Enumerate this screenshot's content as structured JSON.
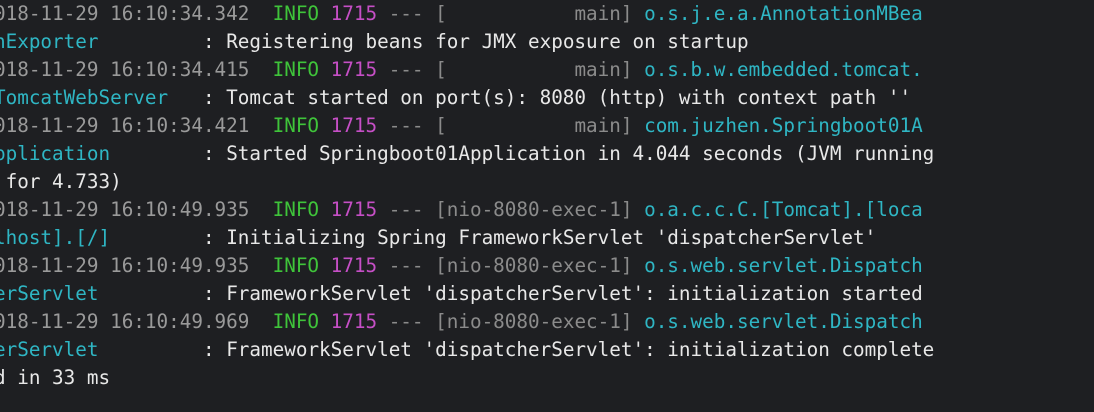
{
  "log": {
    "entries": [
      {
        "timestamp": "018-11-29 16:10:34.342",
        "level": "INFO",
        "pid": "1715",
        "sep": "---",
        "thread": "[           main]",
        "logger_part1": "o.s.j.e.a.AnnotationMBea",
        "logger_part2": "nExporter",
        "colon": ":",
        "message": "Registering beans for JMX exposure on startup",
        "message_cont": ""
      },
      {
        "timestamp": "018-11-29 16:10:34.415",
        "level": "INFO",
        "pid": "1715",
        "sep": "---",
        "thread": "[           main]",
        "logger_part1": "o.s.b.w.embedded.tomcat.",
        "logger_part2": "TomcatWebServer",
        "colon": ":",
        "message": "Tomcat started on port(s): 8080 (http) with context path ''",
        "message_cont": ""
      },
      {
        "timestamp": "018-11-29 16:10:34.421",
        "level": "INFO",
        "pid": "1715",
        "sep": "---",
        "thread": "[           main]",
        "logger_part1": "com.juzhen.Springboot01A",
        "logger_part2": "pplication",
        "colon": ":",
        "message": "Started Springboot01Application in 4.044 seconds (JVM running",
        "message_cont": " for 4.733)"
      },
      {
        "timestamp": "018-11-29 16:10:49.935",
        "level": "INFO",
        "pid": "1715",
        "sep": "---",
        "thread": "[nio-8080-exec-1]",
        "logger_part1": "o.a.c.c.C.[Tomcat].[loca",
        "logger_part2": "lhost].[/]",
        "colon": ":",
        "message": "Initializing Spring FrameworkServlet 'dispatcherServlet'",
        "message_cont": ""
      },
      {
        "timestamp": "018-11-29 16:10:49.935",
        "level": "INFO",
        "pid": "1715",
        "sep": "---",
        "thread": "[nio-8080-exec-1]",
        "logger_part1": "o.s.web.servlet.Dispatch",
        "logger_part2": "erServlet",
        "colon": ":",
        "message": "FrameworkServlet 'dispatcherServlet': initialization started",
        "message_cont": ""
      },
      {
        "timestamp": "018-11-29 16:10:49.969",
        "level": "INFO",
        "pid": "1715",
        "sep": "---",
        "thread": "[nio-8080-exec-1]",
        "logger_part1": "o.s.web.servlet.Dispatch",
        "logger_part2": "erServlet",
        "colon": ":",
        "message": "FrameworkServlet 'dispatcherServlet': initialization complete",
        "message_cont": "d in 33 ms"
      }
    ]
  }
}
